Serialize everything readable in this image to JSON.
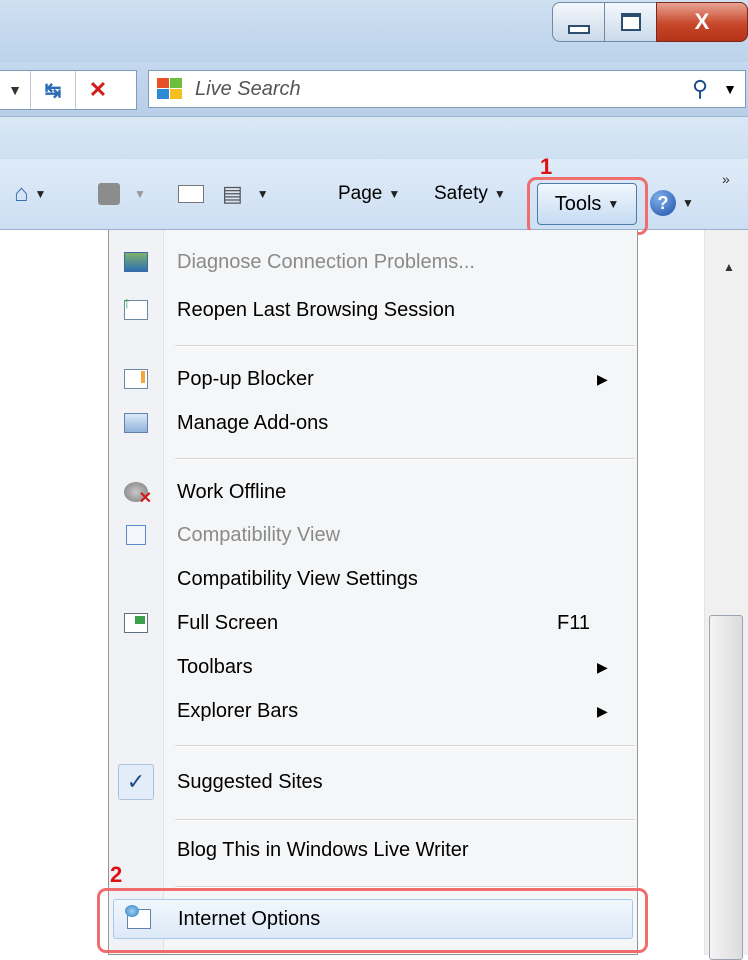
{
  "window": {
    "close_glyph": "X"
  },
  "search": {
    "placeholder": "Live Search"
  },
  "toolbar": {
    "page_label": "Page",
    "safety_label": "Safety",
    "tools_label": "Tools"
  },
  "annotations": {
    "step1": "1",
    "step2": "2"
  },
  "menu": {
    "items": [
      {
        "label": "Diagnose Connection Problems...",
        "disabled": true,
        "icon": "diagnose-icon"
      },
      {
        "label": "Reopen Last Browsing Session",
        "disabled": false,
        "icon": "reopen-session-icon"
      },
      {
        "label": "Pop-up Blocker",
        "disabled": false,
        "icon": "popup-blocker-icon",
        "submenu": true
      },
      {
        "label": "Manage Add-ons",
        "disabled": false,
        "icon": "addons-icon"
      },
      {
        "label": "Work Offline",
        "disabled": false,
        "icon": "work-offline-icon"
      },
      {
        "label": "Compatibility View",
        "disabled": true,
        "icon": "compatibility-view-icon"
      },
      {
        "label": "Compatibility View Settings",
        "disabled": false
      },
      {
        "label": "Full Screen",
        "disabled": false,
        "icon": "fullscreen-icon",
        "shortcut": "F11"
      },
      {
        "label": "Toolbars",
        "disabled": false,
        "submenu": true
      },
      {
        "label": "Explorer Bars",
        "disabled": false,
        "submenu": true
      },
      {
        "label": "Suggested Sites",
        "disabled": false,
        "checked": true
      },
      {
        "label": "Blog This in Windows Live Writer",
        "disabled": false
      },
      {
        "label": "Internet Options",
        "disabled": false,
        "icon": "internet-options-icon",
        "highlighted": true
      }
    ]
  },
  "colors": {
    "annotation_red": "#e01010",
    "callout_border": "#ef6d6d",
    "disabled_text": "#8a8a8a"
  }
}
